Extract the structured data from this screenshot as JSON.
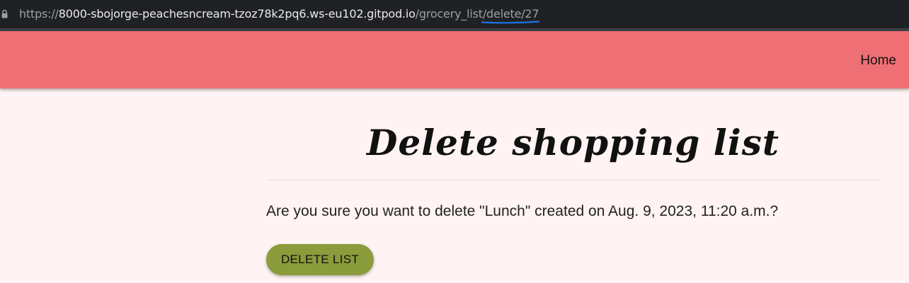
{
  "browser": {
    "url_scheme": "https://",
    "url_host": "8000-sbojorge-peachesncream-tzoz78k2pq6.ws-eu102.gitpod.io",
    "url_path_prefix": "/grocery_list/",
    "url_path_highlight": "delete/27",
    "lock_icon": "lock-icon",
    "annotation_color": "#1a73e8"
  },
  "nav": {
    "home_label": "Home",
    "bar_color": "#ef7074"
  },
  "page": {
    "title": "Delete shopping list",
    "confirm_text": "Are you sure you want to delete \"Lunch\" created on Aug. 9, 2023, 11:20 a.m.?",
    "delete_button_label": "DELETE LIST",
    "button_color": "#8a9c3b",
    "background_color": "#fff4f3"
  }
}
